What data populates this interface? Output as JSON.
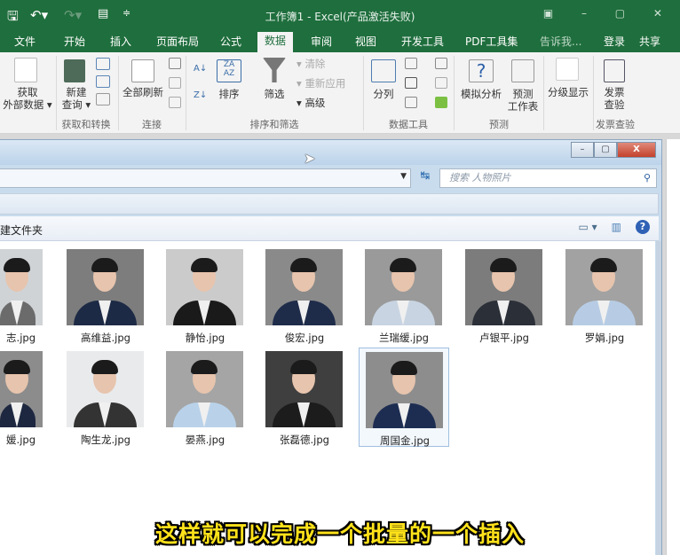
{
  "titlebar": {
    "title": "工作簿1 - Excel(产品激活失败)",
    "save_icon": "save-icon",
    "undo_icon": "undo-icon",
    "redo_icon": "redo-icon",
    "form_icon": "form-icon",
    "window_controls": "▣ – ▢ ✕"
  },
  "tabs": [
    {
      "label": "文件"
    },
    {
      "label": "开始"
    },
    {
      "label": "插入"
    },
    {
      "label": "页面布局"
    },
    {
      "label": "公式"
    },
    {
      "label": "数据",
      "active": true
    },
    {
      "label": "审阅"
    },
    {
      "label": "视图"
    },
    {
      "label": "开发工具"
    },
    {
      "label": "PDF工具集"
    },
    {
      "label": "告诉我..."
    },
    {
      "label": "登录"
    },
    {
      "label": "共享"
    }
  ],
  "ribbon": {
    "get_external": "获取\n外部数据 ▾",
    "new_query": "新建\n查询 ▾",
    "refresh_all": "全部刷新",
    "sort_label": "排序",
    "filter_label": "筛选",
    "clear_label": "清除",
    "reapply_label": "重新应用",
    "advanced_label": "高级",
    "text_to_columns": "分列",
    "what_if": "模拟分析",
    "forecast": "预测\n工作表",
    "outline": "分级显示",
    "invoice": "发票\n查验",
    "groups": [
      "获取和转换",
      "连接",
      "排序和筛选",
      "数据工具",
      "预测",
      "发票查验"
    ]
  },
  "explorer": {
    "search_placeholder": "搜索 人物照片",
    "new_folder": "建文件夹",
    "files": [
      {
        "name": "志.jpg",
        "bg": "#cfd3d6",
        "body": "#6b6b6b"
      },
      {
        "name": "高维益.jpg",
        "bg": "#7d7d7d",
        "body": "#1d2a45"
      },
      {
        "name": "静怡.jpg",
        "bg": "#cbcbcb",
        "body": "#1a1a1a"
      },
      {
        "name": "俊宏.jpg",
        "bg": "#8a8a8a",
        "body": "#1e2c4a"
      },
      {
        "name": "兰瑞缓.jpg",
        "bg": "#9a9a9a",
        "body": "#c8d4e2"
      },
      {
        "name": "卢银平.jpg",
        "bg": "#7c7c7c",
        "body": "#2b2f38"
      },
      {
        "name": "罗娟.jpg",
        "bg": "#a2a2a2",
        "body": "#b7cce4"
      },
      {
        "name": "媛.jpg",
        "bg": "#8c8c8c",
        "body": "#1d2740"
      },
      {
        "name": "陶生龙.jpg",
        "bg": "#e9eaec",
        "body": "#333333"
      },
      {
        "name": "晏燕.jpg",
        "bg": "#a5a5a5",
        "body": "#b9d2ea"
      },
      {
        "name": "张磊德.jpg",
        "bg": "#3f3f3f",
        "body": "#1c1c1c"
      },
      {
        "name": "周国金.jpg",
        "bg": "#8d8d8d",
        "body": "#1d2d52",
        "selected": true
      }
    ]
  },
  "subtitle": "这样就可以完成一个批量的一个插入"
}
